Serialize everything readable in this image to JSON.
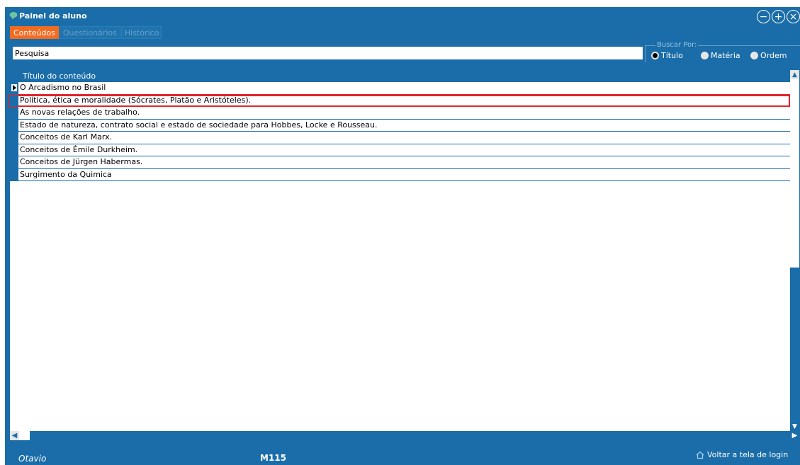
{
  "window": {
    "title": "Painel do aluno",
    "icon": "brain-icon",
    "buttons": [
      {
        "name": "minimize-button",
        "glyph": "−"
      },
      {
        "name": "maximize-button",
        "glyph": "+"
      },
      {
        "name": "close-button",
        "glyph": "×"
      }
    ]
  },
  "tabs": [
    {
      "label": "Conteúdos",
      "active": true
    },
    {
      "label": "Questionários",
      "active": false
    },
    {
      "label": "Histórico",
      "active": false
    }
  ],
  "search": {
    "value": "Pesquisa",
    "group_label": "Buscar Por:",
    "options": [
      {
        "label": "Título",
        "checked": true
      },
      {
        "label": "Matéria",
        "checked": false
      },
      {
        "label": "Ordem",
        "checked": false
      }
    ]
  },
  "grid": {
    "column_header": "Título do conteúdo",
    "rows": [
      "O Arcadismo no Brasil",
      "Política, ética e moralidade (Sócrates, Platão e Aristóteles).",
      "As novas relações de trabalho.",
      "Estado de natureza, contrato social e estado de sociedade para Hobbes, Locke e Rousseau.",
      "Conceitos de Karl Marx.",
      "Conceitos de Émile Durkheim.",
      "Conceitos de Jürgen Habermas.",
      "Surgimento da Quimica"
    ],
    "current_row_index": 0,
    "highlighted_row_index": 1
  },
  "footer": {
    "user": "Otavio",
    "code": "M115",
    "back_link": "Voltar a tela de login"
  },
  "colors": {
    "window_bg": "#1a6da8",
    "active_tab": "#f36b21",
    "highlight_border": "#e0242a"
  }
}
